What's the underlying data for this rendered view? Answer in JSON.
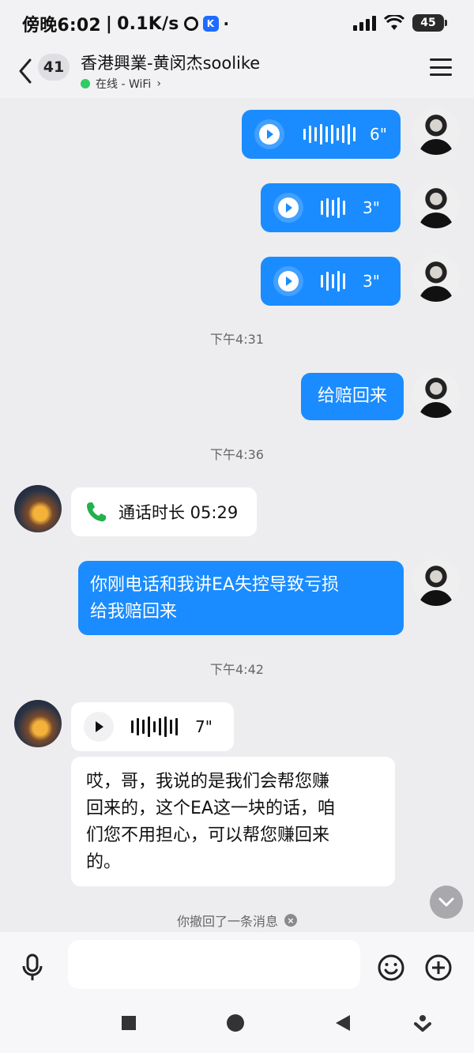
{
  "status_bar": {
    "time": "傍晚6:02",
    "net_speed": "0.1K/s",
    "battery": "45"
  },
  "header": {
    "unread_count": "41",
    "contact_name": "香港興業-黄闵杰soolike",
    "presence": "在线 - WiFi",
    "presence_arrow": "›"
  },
  "messages": {
    "voice1_duration": "6\"",
    "voice2_duration": "3\"",
    "voice3_duration": "3\"",
    "time1": "下午4:31",
    "text1": "给赔回来",
    "time2": "下午4:36",
    "call_text": "通话时长 05:29",
    "text2_line1": "你刚电话和我讲EA失控导致亏损",
    "text2_line2": "给我赔回来",
    "time3": "下午4:42",
    "voice4_duration": "7\"",
    "text3_line1": "哎，哥，我说的是我们会帮您赚",
    "text3_line2": "回来的，这个EA这一块的话，咱",
    "text3_line3": "们您不用担心，可以帮您赚回来",
    "text3_line4": "的。",
    "recall_notice": "你撤回了一条消息"
  },
  "colors": {
    "accent_blue": "#1a8cff",
    "online_green": "#2fcb63",
    "background": "#ededf0"
  }
}
